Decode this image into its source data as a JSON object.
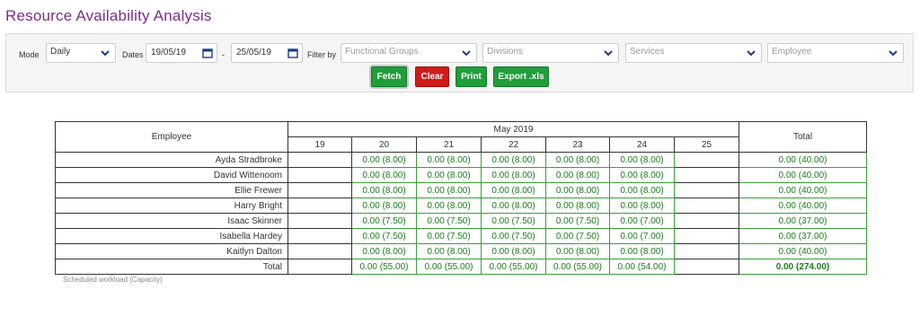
{
  "title": "Resource Availability Analysis",
  "filters": {
    "mode_label": "Mode",
    "mode_value": "Daily",
    "dates_label": "Dates",
    "date_from": "19/05/19",
    "date_sep": "-",
    "date_to": "25/05/19",
    "filter_by_label": "Filter by",
    "functional_groups": "Functional Groups",
    "divisions": "Divisions",
    "services": "Services",
    "employee": "Employee"
  },
  "buttons": {
    "fetch": "Fetch",
    "clear": "Clear",
    "print": "Print",
    "export": "Export .xls"
  },
  "table": {
    "employee_header": "Employee",
    "month_header": "May 2019",
    "total_header": "Total",
    "days": [
      "19",
      "20",
      "21",
      "22",
      "23",
      "24",
      "25"
    ],
    "rows": [
      {
        "name": "Ayda Stradbroke",
        "values": [
          "",
          "0.00 (8.00)",
          "0.00 (8.00)",
          "0.00 (8.00)",
          "0.00 (8.00)",
          "0.00 (8.00)",
          ""
        ],
        "total": "0.00 (40.00)"
      },
      {
        "name": "David Wittenoom",
        "values": [
          "",
          "0.00 (8.00)",
          "0.00 (8.00)",
          "0.00 (8.00)",
          "0.00 (8.00)",
          "0.00 (8.00)",
          ""
        ],
        "total": "0.00 (40.00)"
      },
      {
        "name": "Ellie Frewer",
        "values": [
          "",
          "0.00 (8.00)",
          "0.00 (8.00)",
          "0.00 (8.00)",
          "0.00 (8.00)",
          "0.00 (8.00)",
          ""
        ],
        "total": "0.00 (40.00)"
      },
      {
        "name": "Harry Bright",
        "values": [
          "",
          "0.00 (8.00)",
          "0.00 (8.00)",
          "0.00 (8.00)",
          "0.00 (8.00)",
          "0.00 (8.00)",
          ""
        ],
        "total": "0.00 (40.00)"
      },
      {
        "name": "Isaac Skinner",
        "values": [
          "",
          "0.00 (7.50)",
          "0.00 (7.50)",
          "0.00 (7.50)",
          "0.00 (7.50)",
          "0.00 (7.00)",
          ""
        ],
        "total": "0.00 (37.00)"
      },
      {
        "name": "Isabella Hardey",
        "values": [
          "",
          "0.00 (7.50)",
          "0.00 (7.50)",
          "0.00 (7.50)",
          "0.00 (7.50)",
          "0.00 (7.00)",
          ""
        ],
        "total": "0.00 (37.00)"
      },
      {
        "name": "Kaitlyn Dalton",
        "values": [
          "",
          "0.00 (8.00)",
          "0.00 (8.00)",
          "0.00 (8.00)",
          "0.00 (8.00)",
          "0.00 (8.00)",
          ""
        ],
        "total": "0.00 (40.00)"
      }
    ],
    "total_row": {
      "label": "Total",
      "values": [
        "",
        "0.00 (55.00)",
        "0.00 (55.00)",
        "0.00 (55.00)",
        "0.00 (55.00)",
        "0.00 (54.00)",
        ""
      ],
      "total": "0.00 (274.00)"
    }
  },
  "footnote": "Scheduled workload (Capacity)",
  "colors": {
    "title": "#7b2d8b",
    "green_button": "#1f9e3a",
    "red_button": "#d11a1a",
    "value_text": "#1a7d1a"
  }
}
